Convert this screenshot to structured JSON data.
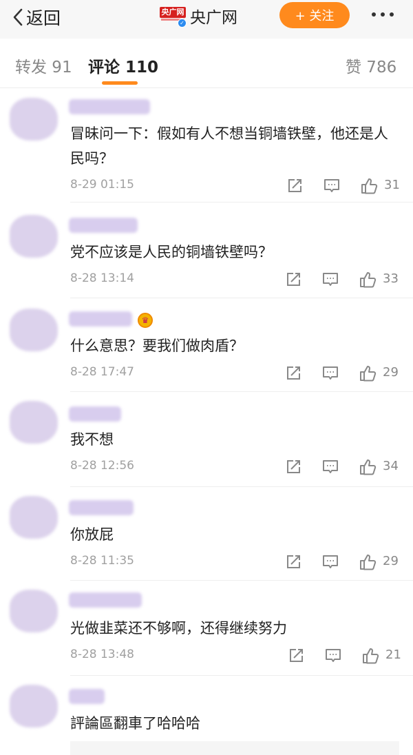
{
  "nav": {
    "back_label": "返回",
    "logo_text": "央广网",
    "account_name": "央广网",
    "follow_label": "+ 关注"
  },
  "tabs": {
    "repost": "转发 91",
    "comments": "评论 110",
    "likes": "赞 786"
  },
  "comments": [
    {
      "text": "冒昧问一下：假如有人不想当铜墙铁壁，他还是人民吗？",
      "time": "8-29 01:15",
      "likes": "31"
    },
    {
      "text": "党不应该是人民的铜墙铁壁吗？",
      "time": "8-28 13:14",
      "likes": "33"
    },
    {
      "text": "什么意思？要我们做肉盾？",
      "time": "8-28 17:47",
      "likes": "29"
    },
    {
      "text": "我不想",
      "time": "8-28 12:56",
      "likes": "34"
    },
    {
      "text": "你放屁",
      "time": "8-28 11:35",
      "likes": "29"
    },
    {
      "text": "光做韭菜还不够啊，还得继续努力",
      "time": "8-28 13:48",
      "likes": "21"
    },
    {
      "text": "評論區翻車了哈哈哈",
      "time": "",
      "likes": ""
    }
  ],
  "colors": {
    "accent": "#ff8a1d",
    "redacted_purple": "#d8cdee",
    "logo_red": "#d6211f"
  },
  "icons": [
    "back-chevron-icon",
    "verified-icon",
    "more-dots-icon",
    "repost-icon",
    "comment-icon",
    "like-icon",
    "vip-crown-icon"
  ]
}
